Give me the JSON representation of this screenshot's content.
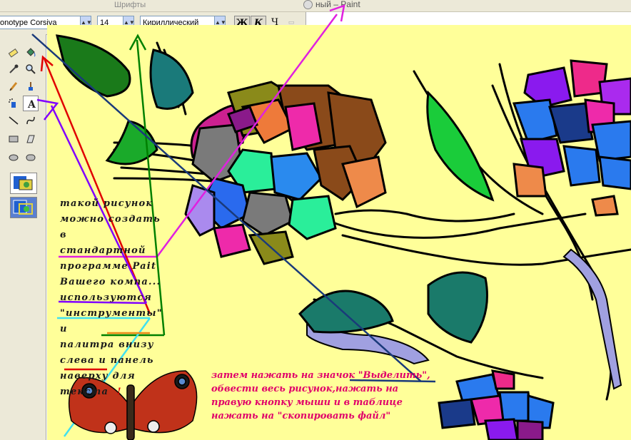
{
  "window": {
    "fonts_dialog_title": "Шрифты",
    "paint_title": "ный – Paint"
  },
  "font_toolbar": {
    "font_name": "onotype Corsiva",
    "font_size": "14",
    "charset": "Кириллический",
    "bold": "Ж",
    "italic": "К",
    "underline": "Ч"
  },
  "toolbox": {
    "tools": [
      {
        "name": "eraser-icon"
      },
      {
        "name": "fill-bucket-icon"
      },
      {
        "name": "eyedropper-icon"
      },
      {
        "name": "magnifier-icon"
      },
      {
        "name": "pencil-icon"
      },
      {
        "name": "brush-icon"
      },
      {
        "name": "airbrush-icon"
      },
      {
        "name": "text-icon",
        "active": true
      },
      {
        "name": "line-icon"
      },
      {
        "name": "curve-icon"
      },
      {
        "name": "rectangle-icon"
      },
      {
        "name": "polygon-icon"
      },
      {
        "name": "ellipse-icon"
      },
      {
        "name": "rounded-rectangle-icon"
      }
    ],
    "options": [
      "opaque-background-option",
      "transparent-background-option"
    ]
  },
  "canvas": {
    "background": "#ffff99",
    "left_note_lines": [
      "такой рисунок",
      "можно создать в",
      "стандартной",
      "программе Pait",
      "Вашего компа...",
      "используются",
      "\"инструменты\" и",
      "палитра внизу",
      "слева и панель",
      "наверху для",
      "текста"
    ],
    "exclamation": "!",
    "bottom_note_lines": [
      "затем нажать на значок \"Выделить\",",
      "обвести весь рисунок,нажать на",
      "правую кнопку мыши и в таблице",
      "нажать на \"скопировать файл\""
    ]
  },
  "colors": {
    "note_left": "#1a1a1a",
    "note_bottom": "#e0006a",
    "arrow_magenta": "#e020e0",
    "arrow_red": "#e00000",
    "arrow_green": "#008000",
    "arrow_purple": "#8000ff",
    "arrow_navy": "#1a3a7a",
    "arrow_cyan": "#40e0f0"
  }
}
